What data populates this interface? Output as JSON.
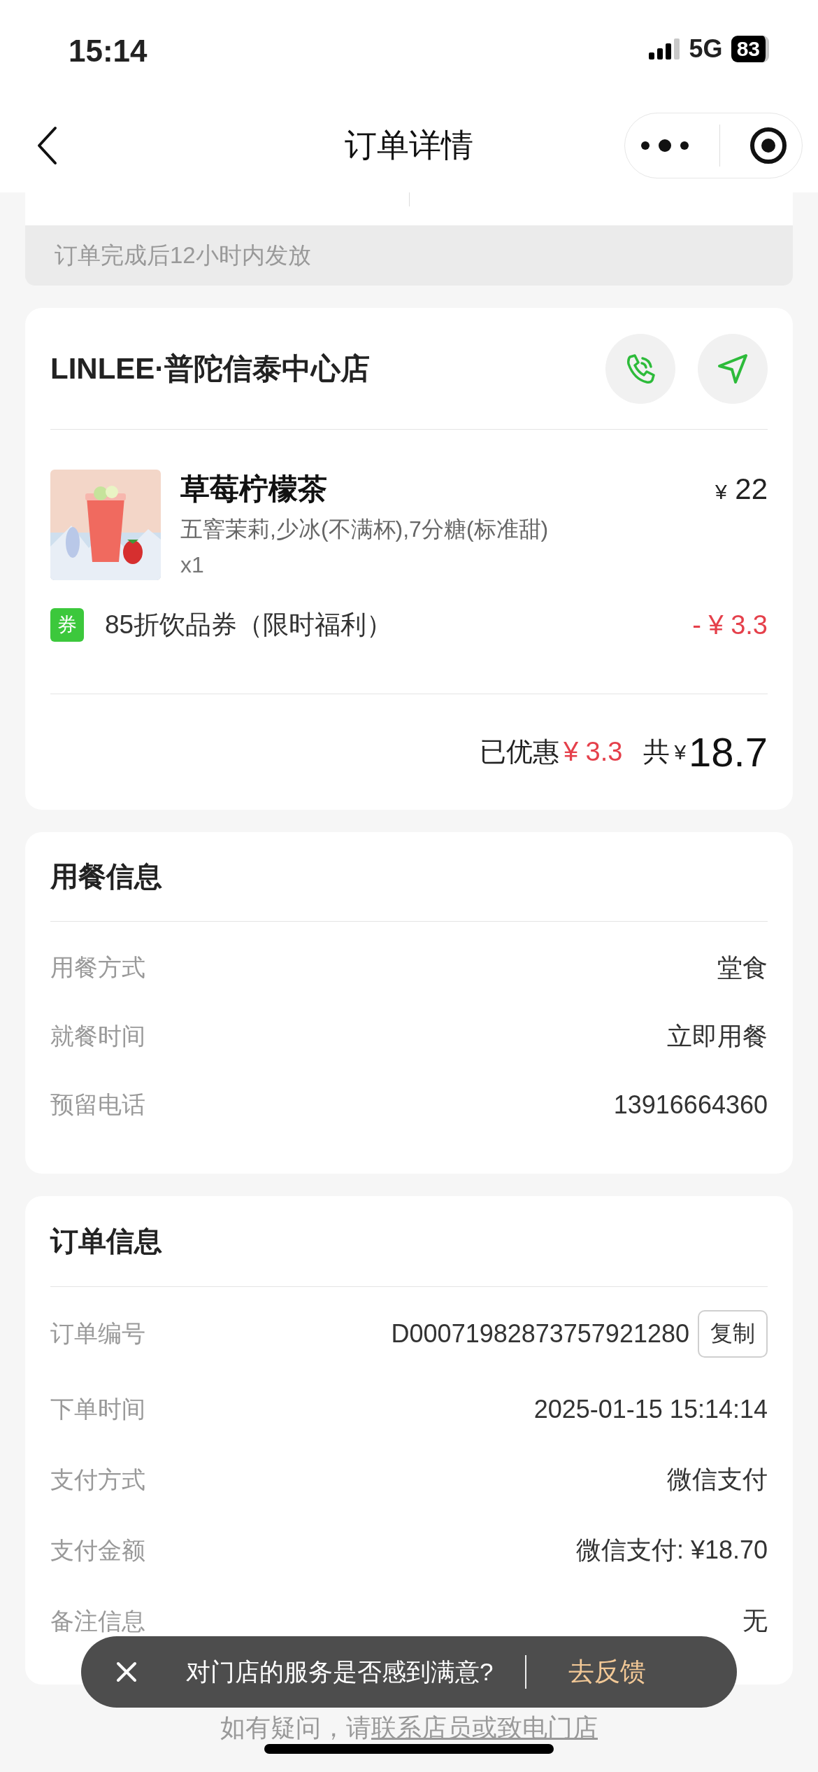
{
  "status_bar": {
    "time": "15:14",
    "network": "5G",
    "battery": "83"
  },
  "nav": {
    "title": "订单详情"
  },
  "notice": {
    "text": "订单完成后12小时内发放"
  },
  "store": {
    "name": "LINLEE·普陀信泰中心店",
    "item": {
      "kind": "picture",
      "name": "草莓柠檬茶",
      "options": "五窨茉莉,少冰(不满杯),7分糖(标准甜)",
      "quantity": "x1",
      "currency": "¥",
      "price": "22"
    },
    "coupon": {
      "badge": "券",
      "label": "85折饮品券（限时福利）",
      "amount": "- ¥ 3.3"
    },
    "summary": {
      "discount_label": "已优惠",
      "discount": "¥ 3.3",
      "total_label": "共",
      "total_currency": "¥",
      "total": "18.7"
    }
  },
  "dining": {
    "title": "用餐信息",
    "rows": [
      {
        "label": "用餐方式",
        "value": "堂食"
      },
      {
        "label": "就餐时间",
        "value": "立即用餐"
      },
      {
        "label": "预留电话",
        "value": "13916664360"
      }
    ]
  },
  "order": {
    "title": "订单信息",
    "rows": [
      {
        "label": "订单编号",
        "value": "D00071982873757921280",
        "action": "复制"
      },
      {
        "label": "下单时间",
        "value": "2025-01-15 15:14:14"
      },
      {
        "label": "支付方式",
        "value": "微信支付"
      },
      {
        "label": "支付金额",
        "value": "微信支付: ¥18.70"
      },
      {
        "label": "备注信息",
        "value": "无"
      }
    ]
  },
  "toast": {
    "question": "对门店的服务是否感到满意?",
    "action": "去反馈"
  },
  "footer": {
    "prefix": "如有疑问，请",
    "link": "联系店员或致电门店"
  }
}
